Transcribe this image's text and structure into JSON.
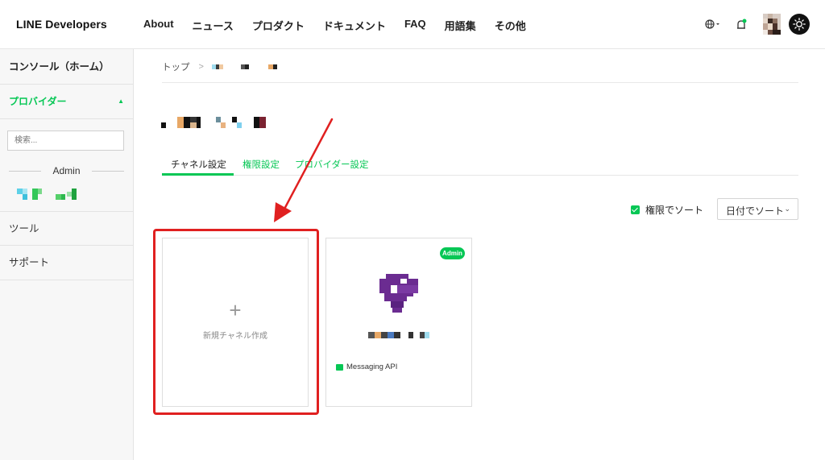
{
  "header": {
    "logo": "LINE Developers",
    "nav": [
      "About",
      "ニュース",
      "プロダクト",
      "ドキュメント",
      "FAQ",
      "用語集",
      "その他"
    ],
    "icons": [
      "globe-icon",
      "bell-icon",
      "avatar",
      "sun-icon"
    ]
  },
  "sidebar": {
    "console": "コンソール（ホーム）",
    "provider": "プロバイダー",
    "search_placeholder": "検索...",
    "admin_label": "Admin",
    "tools": "ツール",
    "support": "サポート"
  },
  "main": {
    "breadcrumb_home": "トップ",
    "breadcrumb_sep": ">",
    "tabs": {
      "channel_settings": "チャネル設定",
      "permissions": "権限設定",
      "provider_settings": "プロバイダー設定"
    },
    "sort_checkbox_label": "権限でソート",
    "sort_select_value": "日付でソート",
    "new_channel_plus": "+",
    "new_channel_label": "新規チャネル作成",
    "channel_card": {
      "badge": "Admin",
      "type": "Messaging API"
    }
  },
  "colors": {
    "accent": "#06c755",
    "highlight": "#e02020",
    "channel_icon": "#6b2c91"
  }
}
